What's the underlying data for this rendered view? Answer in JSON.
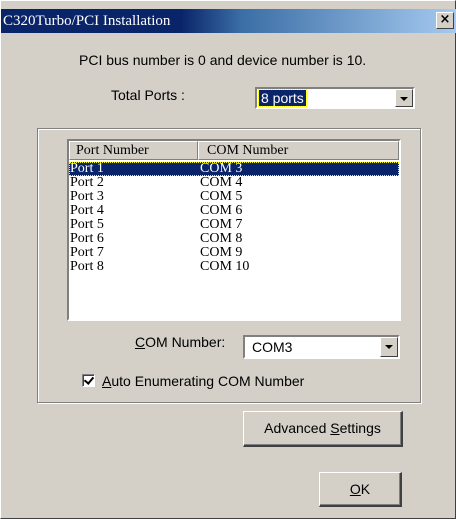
{
  "window": {
    "title": "C320Turbo/PCI Installation",
    "close_glyph": "×"
  },
  "info_text": "PCI bus number is 0 and device number is 10.",
  "total_ports": {
    "label": "Total Ports :",
    "value": "8 ports"
  },
  "port_list": {
    "columns": [
      "Port Number",
      "COM Number"
    ],
    "rows": [
      {
        "port": "Port 1",
        "com": "COM 3",
        "selected": true
      },
      {
        "port": "Port 2",
        "com": "COM 4"
      },
      {
        "port": "Port 3",
        "com": "COM 5"
      },
      {
        "port": "Port 4",
        "com": "COM 6"
      },
      {
        "port": "Port 5",
        "com": "COM 7"
      },
      {
        "port": "Port 6",
        "com": "COM 8"
      },
      {
        "port": "Port 7",
        "com": "COM 9"
      },
      {
        "port": "Port 8",
        "com": "COM 10"
      }
    ]
  },
  "com_number": {
    "label_mnemonic": "C",
    "label_rest": "OM Number:",
    "value": "COM3"
  },
  "auto_enum": {
    "checked": true,
    "label_mnemonic": "A",
    "label_rest": "uto Enumerating COM Number"
  },
  "advanced_button": {
    "label_pre": "Advanced ",
    "label_mnemonic": "S",
    "label_post": "ettings"
  },
  "ok_button": {
    "label_mnemonic": "O",
    "label_rest": "K"
  },
  "colors": {
    "title_active": "#0a246a",
    "face": "#d4d0c8",
    "selection": "#0a246a"
  }
}
